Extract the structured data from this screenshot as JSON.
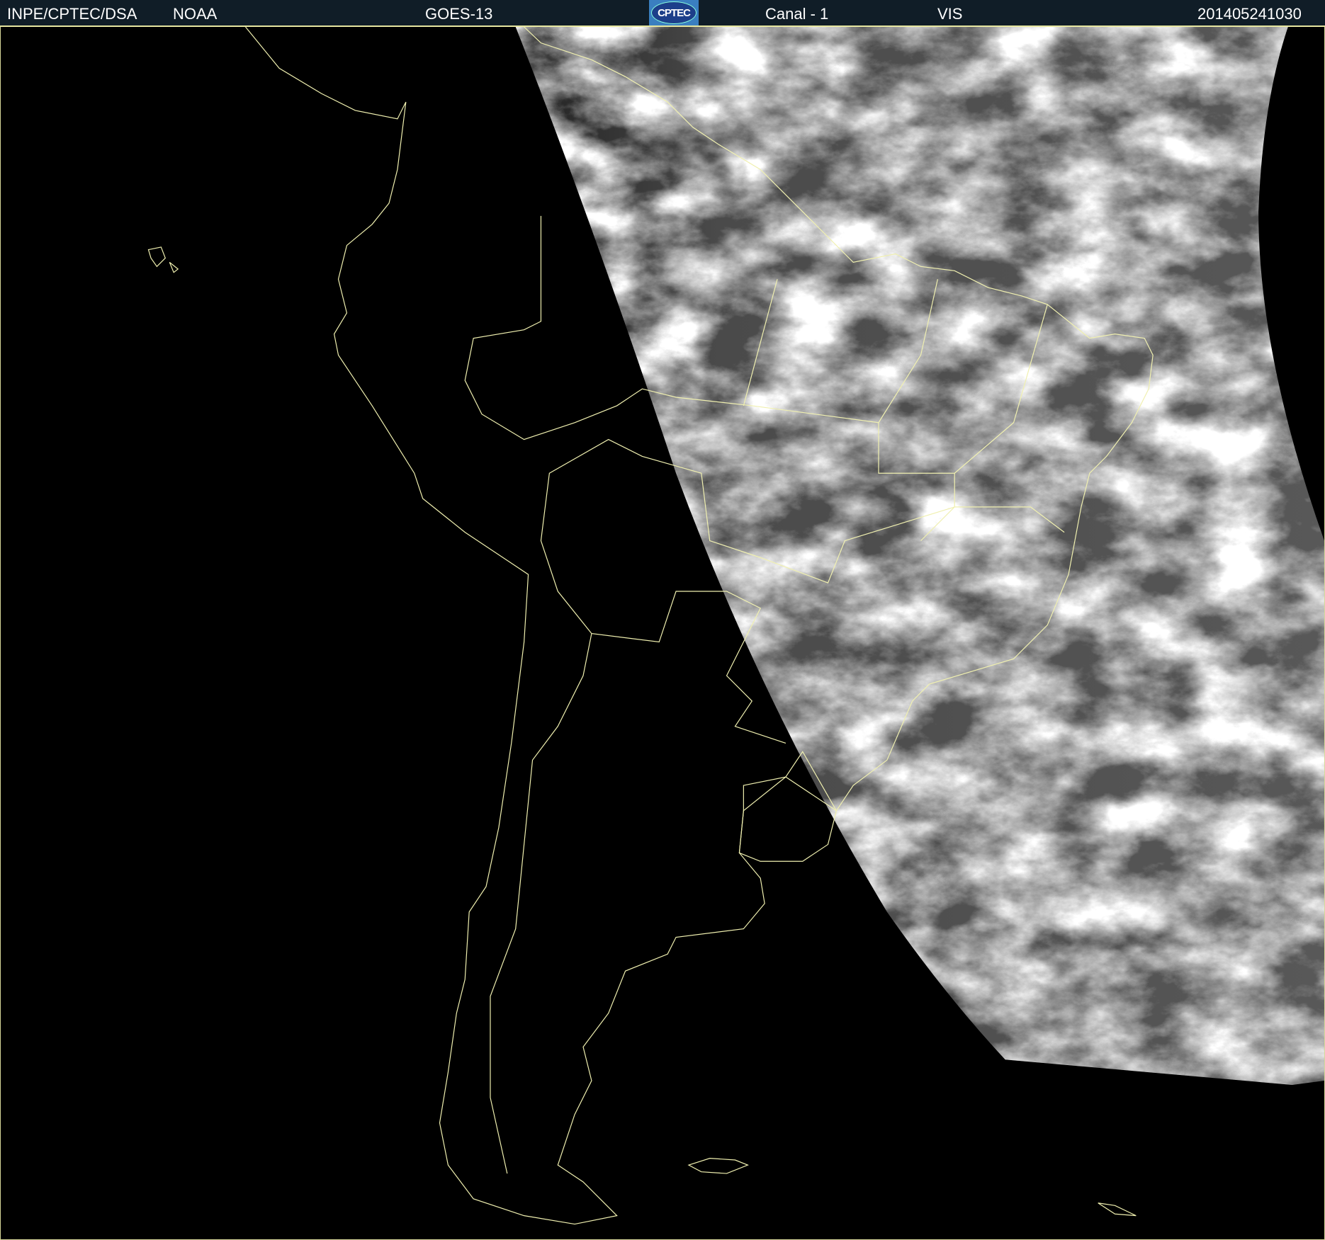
{
  "header": {
    "source": "INPE/CPTEC/DSA",
    "agency": "NOAA",
    "satellite": "GOES-13",
    "logo_text": "CPTEC",
    "channel": "Canal - 1",
    "band": "VIS",
    "timestamp": "201405241030"
  },
  "colors": {
    "header_bg": "#101d27",
    "border": "#e6e6a0",
    "coastline": "#f0f0b0"
  }
}
